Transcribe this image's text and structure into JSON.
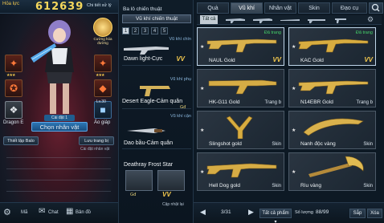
{
  "player": {
    "rank_label": "Hỏa lực",
    "score": "612639",
    "detail_link": "Chi tiết xử lý",
    "equip_count": "Cài đặt 1",
    "choose_char": "Chọn nhân vật",
    "banner_label": "Cường hóa đường",
    "dragon_label": "Dragon E",
    "armor_label": "Áo giáp",
    "lv_label": "Lv.30",
    "settings_label": "Thiết lập Balo",
    "save_label": "Lưu trang bị",
    "more_label": "Cài đặt nhân vật"
  },
  "left_bottom": [
    "Mã",
    "Chat",
    "Bản đồ"
  ],
  "middle": {
    "title": "Ba lô chiến thuật",
    "tab": "Vũ khí chiến thuật",
    "pages": [
      "1",
      "2",
      "3",
      "4",
      "5"
    ],
    "slots": [
      {
        "category": "Vũ khí chín",
        "name": "Dawn light-Cực",
        "grade": "VV",
        "badge": "Gđ"
      },
      {
        "category": "Vũ khí phụ",
        "name": "Desert Eagle-Cảm quân",
        "grade": "VV",
        "badge": "Gđ"
      },
      {
        "category": "Vũ khí cận",
        "name": "Dao bầu-Cảm quân",
        "grade": "VV",
        "badge": "Gđ"
      },
      {
        "category": "",
        "name": "Deathray Frost Star",
        "grade": "VV",
        "badge": "Gđ"
      }
    ],
    "bottom_btn": "Cập nhật lại"
  },
  "tabs": [
    "Quà",
    "Vũ khí",
    "Nhân vật",
    "Skin",
    "Đạo cụ"
  ],
  "active_tab": "Vũ khí",
  "subtabs": [
    "Tất cả"
  ],
  "cards": [
    {
      "name": "NAUL Gold",
      "grade": "VV",
      "lock": "Đã trang",
      "extra": ""
    },
    {
      "name": "KAC Gold",
      "grade": "VV",
      "lock": "Đã trang",
      "extra": ""
    },
    {
      "name": "HK-G11 Gold",
      "grade": "",
      "lock": "",
      "extra": "Trang b"
    },
    {
      "name": "N14EBR Gold",
      "grade": "",
      "lock": "",
      "extra": "Trang b"
    },
    {
      "name": "Slingshot gold",
      "grade": "",
      "lock": "",
      "extra": "Skin"
    },
    {
      "name": "Nanh độc vàng",
      "grade": "",
      "lock": "",
      "extra": "Skin"
    },
    {
      "name": "Hell Dog gold",
      "grade": "",
      "lock": "",
      "extra": "Skin"
    },
    {
      "name": "Rìu vàng",
      "grade": "",
      "lock": "",
      "extra": "Skin"
    }
  ],
  "footer": {
    "pager": "3/31",
    "filter": "Tất cả phẩm",
    "capacity_label": "Số lượng",
    "capacity": "88/99",
    "refresh": "Sắp",
    "delete": "Xóa"
  },
  "colors": {
    "gold": "#f3c84e",
    "accent_blue": "#2c76b5",
    "equipped_green": "#45d36a"
  }
}
